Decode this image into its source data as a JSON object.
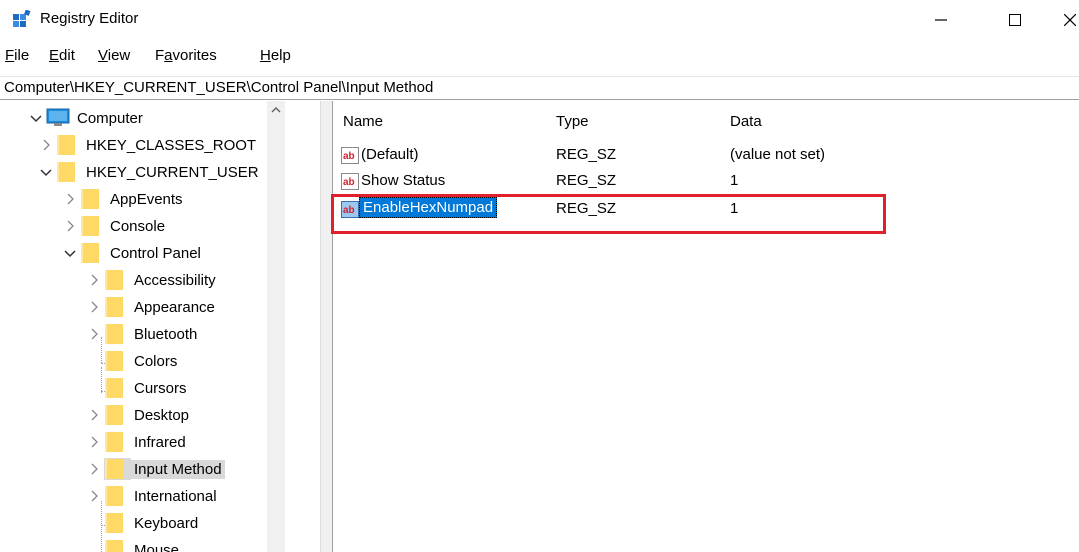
{
  "window": {
    "title": "Registry Editor"
  },
  "menu": {
    "file": {
      "key": "F",
      "rest": "ile"
    },
    "edit": {
      "key": "E",
      "rest": "dit"
    },
    "view": {
      "key": "V",
      "rest": "iew"
    },
    "favorites": {
      "pre": "F",
      "key": "a",
      "rest": "vorites"
    },
    "help": {
      "key": "H",
      "rest": "elp"
    }
  },
  "address": "Computer\\HKEY_CURRENT_USER\\Control Panel\\Input Method",
  "tree": {
    "computer": "Computer",
    "hkcr": "HKEY_CLASSES_ROOT",
    "hkcu": "HKEY_CURRENT_USER",
    "appevents": "AppEvents",
    "console": "Console",
    "control_panel": "Control Panel",
    "accessibility": "Accessibility",
    "appearance": "Appearance",
    "bluetooth": "Bluetooth",
    "colors": "Colors",
    "cursors": "Cursors",
    "desktop": "Desktop",
    "infrared": "Infrared",
    "input_method": "Input Method",
    "international": "International",
    "keyboard": "Keyboard",
    "mouse": "Mouse"
  },
  "list": {
    "headers": {
      "name": "Name",
      "type": "Type",
      "data": "Data"
    },
    "rows": [
      {
        "name": "(Default)",
        "type": "REG_SZ",
        "data": "(value not set)"
      },
      {
        "name": "Show Status",
        "type": "REG_SZ",
        "data": "1"
      },
      {
        "name": "EnableHexNumpad",
        "type": "REG_SZ",
        "data": "1"
      }
    ]
  },
  "colors": {
    "selection": "#0078d7",
    "highlight_box": "#e0202a",
    "folder": "#ffd966"
  },
  "icons": {
    "app": "registry-editor-icon",
    "value": "string-value-icon",
    "folder": "folder-icon"
  }
}
